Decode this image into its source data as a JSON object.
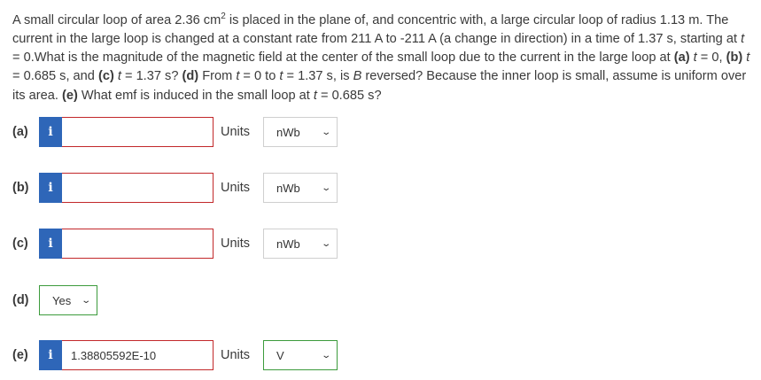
{
  "question": {
    "p1": "A small circular loop of area 2.36 cm",
    "sup": "2",
    "p2": " is placed in the plane of, and concentric with, a large circular loop of radius 1.13 m. The current in the large loop is changed at a constant rate from 211 A to -211 A (a change in direction) in a time of 1.37 s, starting at ",
    "t1": "t",
    "p3": " = 0.What is the magnitude of the magnetic field at the center of the small loop due to the current in the large loop at ",
    "a": "(a)",
    "t2": "t",
    "p4": " = 0, ",
    "b": "(b)",
    "t3": "t",
    "p5": " = 0.685 s, and ",
    "c": "(c)",
    "t4": "t",
    "p6": " = 1.37 s? ",
    "d": "(d)",
    "p7": " From ",
    "t5": "t",
    "p8": " = 0 to ",
    "t6": "t",
    "p9": " = 1.37 s, is ",
    "B": "B",
    "p10": " reversed? Because the inner loop is small, assume is uniform over its area. ",
    "e": "(e)",
    "p11": " What emf is induced in the small loop at ",
    "t7": "t",
    "p12": " = 0.685 s?"
  },
  "info_icon": "i",
  "units_label": "Units",
  "parts": [
    {
      "label": "(a)",
      "value": "",
      "unit": "nWb"
    },
    {
      "label": "(b)",
      "value": "",
      "unit": "nWb"
    },
    {
      "label": "(c)",
      "value": "",
      "unit": "nWb"
    },
    {
      "label": "(d)",
      "select_value": "Yes"
    },
    {
      "label": "(e)",
      "value": "1.38805592E-10",
      "unit": "V"
    }
  ],
  "icons": {
    "dropdown": "chevron-down-icon",
    "info": "info-icon"
  },
  "colors": {
    "info_bg": "#2e66b8",
    "error_border": "#c2282a",
    "ok_border": "#3c9b3c"
  }
}
